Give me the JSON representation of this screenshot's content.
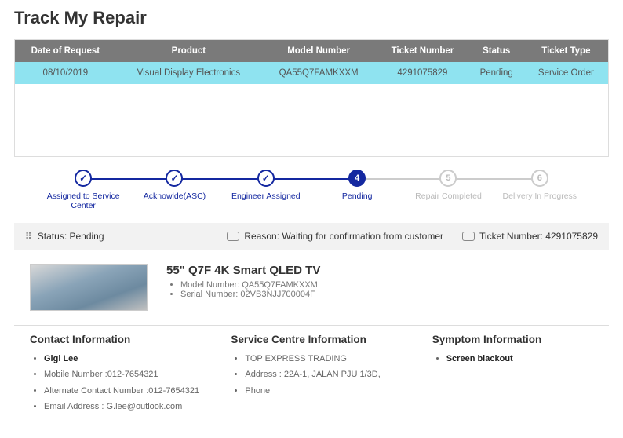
{
  "title": "Track My Repair",
  "table": {
    "headers": [
      "Date of Request",
      "Product",
      "Model Number",
      "Ticket Number",
      "Status",
      "Ticket Type"
    ],
    "row": {
      "date": "08/10/2019",
      "product": "Visual Display Electronics",
      "model": "QA55Q7FAMKXXM",
      "ticket": "4291075829",
      "status": "Pending",
      "type": "Service Order"
    }
  },
  "steps": [
    {
      "label": "Assigned to Service Center",
      "mark": "✓",
      "state": "done"
    },
    {
      "label": "Acknowlde(ASC)",
      "mark": "✓",
      "state": "done"
    },
    {
      "label": "Engineer Assigned",
      "mark": "✓",
      "state": "done"
    },
    {
      "label": "Pending",
      "mark": "4",
      "state": "current"
    },
    {
      "label": "Repair Completed",
      "mark": "5",
      "state": "future"
    },
    {
      "label": "Delivery In Progress",
      "mark": "6",
      "state": "future"
    }
  ],
  "statusbar": {
    "status": "Status: Pending",
    "reason": "Reason: Waiting for confirmation from customer",
    "ticket": "Ticket Number: 4291075829"
  },
  "product": {
    "name": "55\" Q7F 4K Smart QLED TV",
    "model_label": "Model Number: QA55Q7FAMKXXM",
    "serial_label": "Serial Number: 02VB3NJJ700004F"
  },
  "contact": {
    "heading": "Contact Information",
    "name": "Gigi Lee",
    "mobile_label": "Mobile Number :",
    "mobile": "012-7654321",
    "alt_label": "Alternate Contact Number :",
    "alt": "012-7654321",
    "email_label": "Email Address :",
    "email": "G.lee@outlook.com"
  },
  "service": {
    "heading": "Service Centre Information",
    "name": "TOP EXPRESS TRADING",
    "addr_label": "Address : 22A-1, JALAN PJU 1/3D,",
    "phone_label": "Phone"
  },
  "symptom": {
    "heading": "Symptom Information",
    "text": "Screen blackout"
  }
}
